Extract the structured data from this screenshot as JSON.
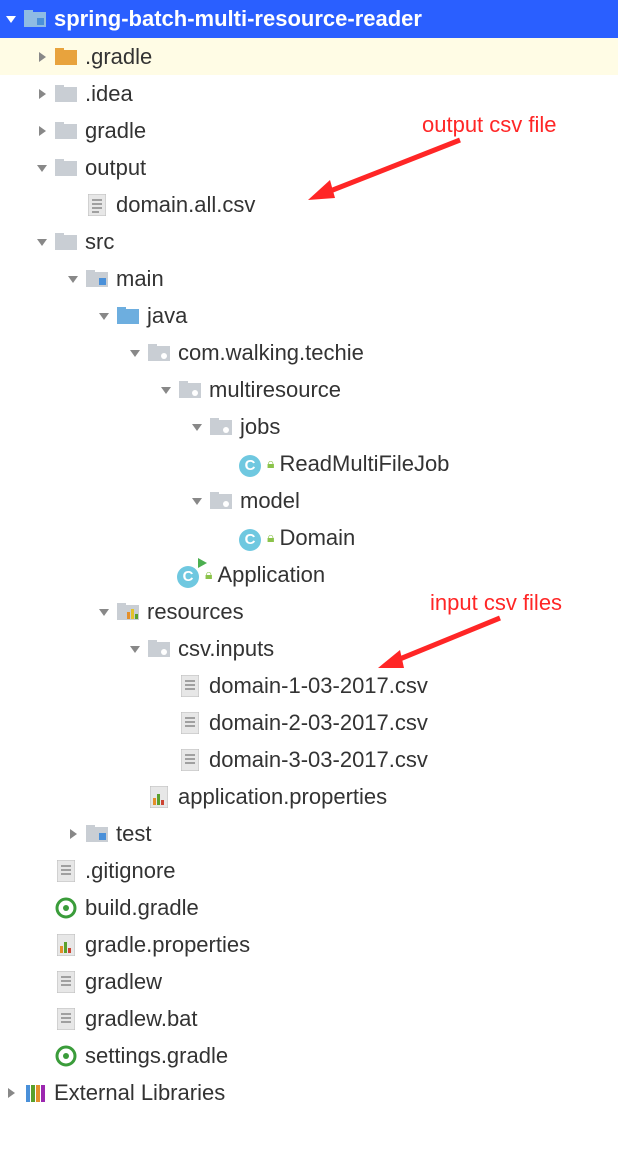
{
  "annotations": {
    "output": "output csv file",
    "input": "input csv files"
  },
  "tree": {
    "root": "spring-batch-multi-resource-reader",
    "gradle_dot": ".gradle",
    "idea": ".idea",
    "gradle": "gradle",
    "output": "output",
    "domain_all": "domain.all.csv",
    "src": "src",
    "main": "main",
    "java": "java",
    "pkg": "com.walking.techie",
    "multiresource": "multiresource",
    "jobs": "jobs",
    "readjob": "ReadMultiFileJob",
    "model": "model",
    "domain": "Domain",
    "application": "Application",
    "resources": "resources",
    "csv_inputs": "csv.inputs",
    "csv1": "domain-1-03-2017.csv",
    "csv2": "domain-2-03-2017.csv",
    "csv3": "domain-3-03-2017.csv",
    "app_props": "application.properties",
    "test": "test",
    "gitignore": ".gitignore",
    "build_gradle": "build.gradle",
    "gradle_props": "gradle.properties",
    "gradlew": "gradlew",
    "gradlew_bat": "gradlew.bat",
    "settings_gradle": "settings.gradle",
    "external": "External Libraries"
  }
}
